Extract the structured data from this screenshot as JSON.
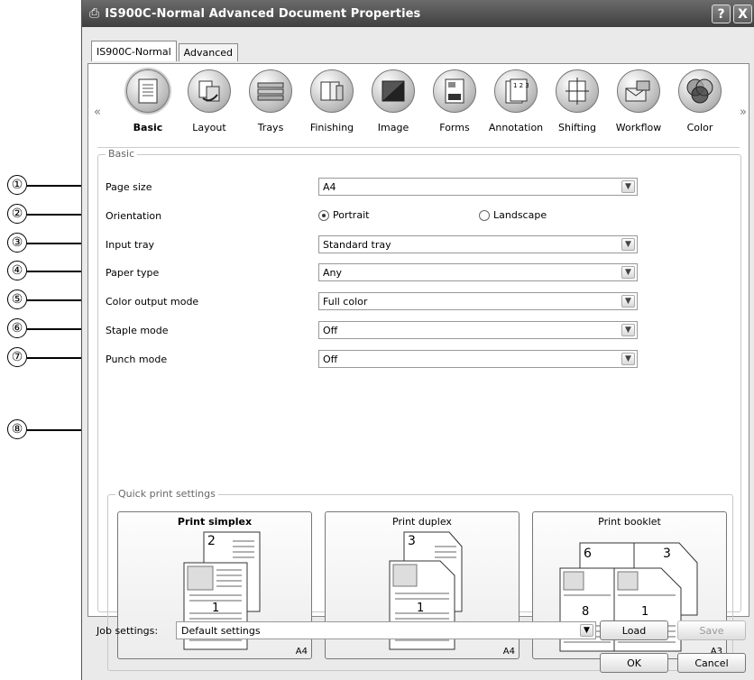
{
  "window": {
    "title": "IS900C-Normal Advanced Document Properties",
    "help_label": "?",
    "close_label": "X"
  },
  "tabs": [
    {
      "label": "IS900C-Normal",
      "active": true
    },
    {
      "label": "Advanced",
      "active": false
    }
  ],
  "categories": [
    {
      "label": "Basic",
      "icon": "document-icon",
      "active": true
    },
    {
      "label": "Layout",
      "icon": "layout-icon"
    },
    {
      "label": "Trays",
      "icon": "trays-icon"
    },
    {
      "label": "Finishing",
      "icon": "finishing-icon"
    },
    {
      "label": "Image",
      "icon": "image-icon"
    },
    {
      "label": "Forms",
      "icon": "forms-icon"
    },
    {
      "label": "Annotation",
      "icon": "annotation-icon"
    },
    {
      "label": "Shifting",
      "icon": "shifting-icon"
    },
    {
      "label": "Workflow",
      "icon": "workflow-icon"
    },
    {
      "label": "Color",
      "icon": "color-icon"
    }
  ],
  "nav": {
    "prev": "«",
    "next": "»"
  },
  "basic": {
    "group_title": "Basic",
    "page_size_label": "Page size",
    "page_size_value": "A4",
    "orientation_label": "Orientation",
    "orientation_portrait": "Portrait",
    "orientation_landscape": "Landscape",
    "orientation_selected": "Portrait",
    "input_tray_label": "Input tray",
    "input_tray_value": "Standard tray",
    "paper_type_label": "Paper type",
    "paper_type_value": "Any",
    "color_mode_label": "Color output mode",
    "color_mode_value": "Full color",
    "staple_label": "Staple mode",
    "staple_value": "Off",
    "punch_label": "Punch mode",
    "punch_value": "Off"
  },
  "quick_print": {
    "title": "Quick print settings",
    "buttons": [
      {
        "label": "Print simplex",
        "size": "A4",
        "selected": true
      },
      {
        "label": "Print duplex",
        "size": "A4",
        "selected": false
      },
      {
        "label": "Print booklet",
        "size": "A3",
        "selected": false
      }
    ]
  },
  "job": {
    "label": "Job settings:",
    "value": "Default settings",
    "load": "Load",
    "save": "Save"
  },
  "footer": {
    "ok": "OK",
    "cancel": "Cancel"
  },
  "callouts": [
    "①",
    "②",
    "③",
    "④",
    "⑤",
    "⑥",
    "⑦",
    "⑧"
  ]
}
